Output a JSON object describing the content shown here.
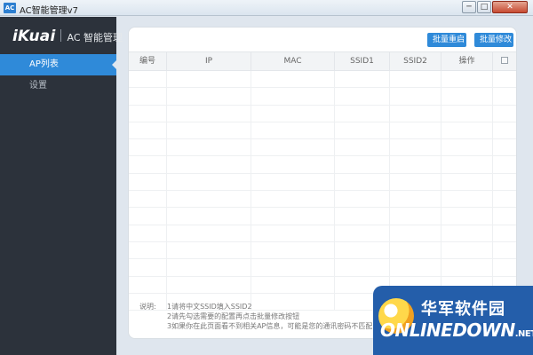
{
  "window": {
    "app_icon": "AC",
    "title": "AC智能管理v7",
    "minimize": "─",
    "maximize": "□",
    "close": "✕"
  },
  "sidebar": {
    "logo_brand": "iKuai",
    "logo_sub": "AC 智能管理",
    "items": [
      {
        "label": "AP列表",
        "active": true
      },
      {
        "label": "设置",
        "active": false
      }
    ]
  },
  "toolbar": {
    "restart_label": "批量重启",
    "edit_label": "批量修改"
  },
  "table": {
    "columns": [
      "编号",
      "IP",
      "MAC",
      "SSID1",
      "SSID2",
      "操作"
    ],
    "select_all_checkbox": false,
    "rows": []
  },
  "notes": {
    "label": "说明:",
    "lines": [
      "1请将中文SSID填入SSID2",
      "2请先勾选需要的配置再点击批量修改按钮",
      "3如果你在此页面看不到相关AP信息，可能是您的通讯密码不匹配，请"
    ]
  },
  "watermark": {
    "cn": "华军软件园",
    "en": "ONLINEDOWN",
    "suffix": ".NET"
  },
  "colors": {
    "accent": "#2f8ad9",
    "sidebar_bg": "#2c323b",
    "content_bg": "#dfe6ee"
  }
}
